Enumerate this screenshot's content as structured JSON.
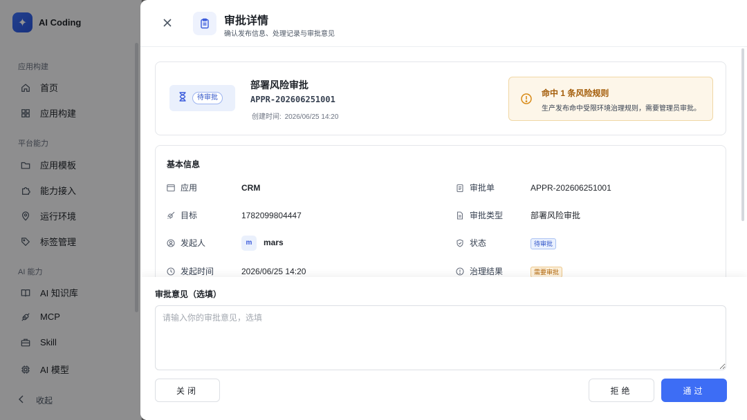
{
  "brand": {
    "name": "AI Coding"
  },
  "sidebar": {
    "sections": [
      {
        "title": "应用构建",
        "items": [
          {
            "label": "首页",
            "icon": "home-icon"
          },
          {
            "label": "应用构建",
            "icon": "grid-icon"
          }
        ]
      },
      {
        "title": "平台能力",
        "items": [
          {
            "label": "应用模板",
            "icon": "folder-icon"
          },
          {
            "label": "能力接入",
            "icon": "puzzle-icon"
          },
          {
            "label": "运行环境",
            "icon": "location-icon"
          },
          {
            "label": "标签管理",
            "icon": "tag-icon"
          }
        ]
      },
      {
        "title": "AI 能力",
        "items": [
          {
            "label": "AI 知识库",
            "icon": "book-icon"
          },
          {
            "label": "MCP",
            "icon": "plug-icon"
          },
          {
            "label": "Skill",
            "icon": "briefcase-icon"
          },
          {
            "label": "AI 模型",
            "icon": "chip-icon"
          }
        ]
      }
    ],
    "collapse_label": "收起"
  },
  "drawer": {
    "title": "审批详情",
    "subtitle": "确认发布信息、处理记录与审批意见",
    "summary": {
      "status": "待审批",
      "title": "部署风险审批",
      "code": "APPR-202606251001",
      "created_label": "创建时间:",
      "created_value": "2026/06/25 14:20"
    },
    "risk": {
      "title": "命中 1 条风险规则",
      "desc": "生产发布命中受限环境治理规则，需要管理员审批。"
    },
    "basic": {
      "title": "基本信息",
      "app_label": "应用",
      "app_value": "CRM",
      "order_label": "审批单",
      "order_value": "APPR-202606251001",
      "target_label": "目标",
      "target_value": "1782099804447",
      "type_label": "审批类型",
      "type_value": "部署风险审批",
      "initiator_label": "发起人",
      "initiator_avatar": "m",
      "initiator_value": "mars",
      "status_label": "状态",
      "status_value": "待审批",
      "time_label": "发起时间",
      "time_value": "2026/06/25 14:20",
      "result_label": "治理结果",
      "result_value": "需要审批"
    },
    "opinion": {
      "label": "审批意见（选填）",
      "placeholder": "请输入你的审批意见，选填",
      "value": ""
    },
    "buttons": {
      "close": "关闭",
      "reject": "拒绝",
      "approve": "通过"
    }
  },
  "colors": {
    "primary": "#3d6df5",
    "warning": "#d88a16",
    "overlay": "rgba(0,0,0,0.42)"
  }
}
